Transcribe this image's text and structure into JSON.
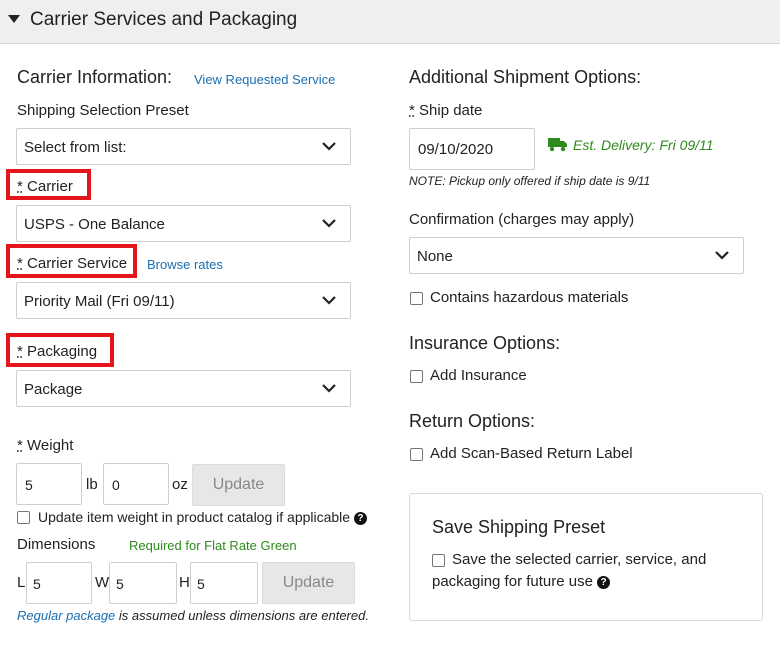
{
  "header": {
    "title": "Carrier Services and Packaging"
  },
  "carrier_info": {
    "title": "Carrier Information:",
    "view_link": "View Requested Service",
    "preset_label": "Shipping Selection Preset",
    "preset_value": "Select from list:",
    "carrier_label": "Carrier",
    "carrier_value": "USPS - One Balance",
    "service_label": "Carrier Service",
    "browse_rates": "Browse rates",
    "service_value": "Priority Mail (Fri 09/11)",
    "packaging_label": "Packaging",
    "packaging_value": "Package",
    "required_marker": "*"
  },
  "weight": {
    "label": "Weight",
    "lb_value": "5",
    "lb_unit": "lb",
    "oz_value": "0",
    "oz_unit": "oz",
    "update_label": "Update",
    "catalog_checkbox": "Update item weight in product catalog if applicable"
  },
  "dimensions": {
    "label": "Dimensions",
    "note": "Required for Flat Rate Green",
    "l_label": "L",
    "l_value": "5",
    "w_label": "W",
    "w_value": "5",
    "h_label": "H",
    "h_value": "5",
    "update_label": "Update",
    "footer_link": "Regular package",
    "footer_text": "is assumed unless dimensions are entered."
  },
  "additional": {
    "title": "Additional Shipment Options:",
    "ship_date_label": "Ship date",
    "ship_date_value": "09/10/2020",
    "est_delivery": "Est. Delivery: Fri 09/11",
    "note": "NOTE: Pickup only offered if ship date is 9/11",
    "confirmation_label": "Confirmation (charges may apply)",
    "confirmation_value": "None",
    "hazardous_label": "Contains hazardous materials"
  },
  "insurance": {
    "title": "Insurance Options:",
    "add_label": "Add Insurance"
  },
  "returns": {
    "title": "Return Options:",
    "add_label": "Add Scan-Based Return Label"
  },
  "preset_panel": {
    "title": "Save Shipping Preset",
    "line1": "Save the selected carrier, service, and",
    "line2": "packaging for future use"
  },
  "colors": {
    "accent_link": "#1a6fb3",
    "success_green": "#2e8b1e",
    "highlight_red": "#e4151b"
  }
}
